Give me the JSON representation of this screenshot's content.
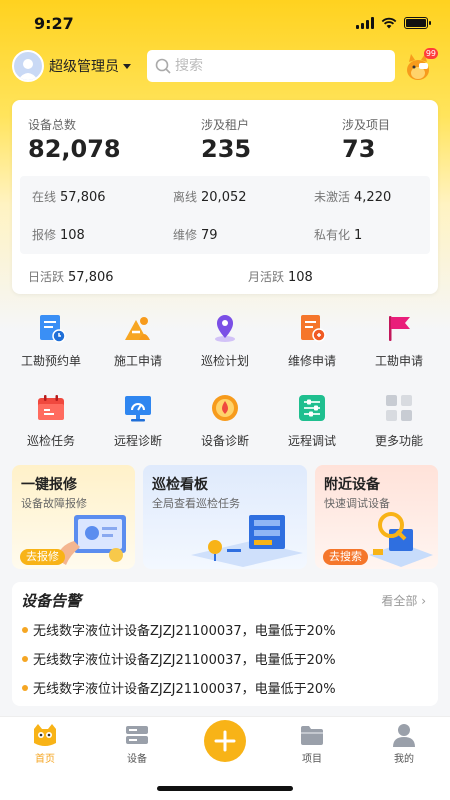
{
  "status_bar": {
    "time": "9:27"
  },
  "header": {
    "user_name": "超级管理员",
    "search_placeholder": "搜索",
    "notification_count": "99"
  },
  "stats": {
    "total_devices_label": "设备总数",
    "total_devices": "82,078",
    "tenants_label": "涉及租户",
    "tenants": "235",
    "projects_label": "涉及项目",
    "projects": "73",
    "online_label": "在线",
    "online": "57,806",
    "offline_label": "离线",
    "offline": "20,052",
    "inactive_label": "未激活",
    "inactive": "4,220",
    "reported_label": "报修",
    "reported": "108",
    "repairing_label": "维修",
    "repairing": "79",
    "private_label": "私有化",
    "private": "1",
    "daily_active_label": "日活跃",
    "daily_active": "57,806",
    "monthly_active_label": "月活跃",
    "monthly_active": "108"
  },
  "menu": [
    {
      "label": "工勘预约单",
      "icon": "survey-order-icon"
    },
    {
      "label": "施工申请",
      "icon": "construction-icon"
    },
    {
      "label": "巡检计划",
      "icon": "location-pin-icon"
    },
    {
      "label": "维修申请",
      "icon": "repair-form-icon"
    },
    {
      "label": "工勘申请",
      "icon": "flag-icon"
    },
    {
      "label": "巡检任务",
      "icon": "calendar-task-icon"
    },
    {
      "label": "远程诊断",
      "icon": "monitor-gauge-icon"
    },
    {
      "label": "设备诊断",
      "icon": "device-diagnosis-icon"
    },
    {
      "label": "远程调试",
      "icon": "sliders-icon"
    },
    {
      "label": "更多功能",
      "icon": "grid-more-icon"
    }
  ],
  "promos": [
    {
      "title": "一键报修",
      "subtitle": "设备故障报修",
      "button": "去报修"
    },
    {
      "title": "巡检看板",
      "subtitle": "全局查看巡检任务"
    },
    {
      "title": "附近设备",
      "subtitle": "快速调试设备",
      "button": "去搜索"
    }
  ],
  "alerts": {
    "title": "设备告警",
    "more": "看全部",
    "items": [
      "无线数字液位计设备ZJZJ21100037，电量低于20%",
      "无线数字液位计设备ZJZJ21100037，电量低于20%",
      "无线数字液位计设备ZJZJ21100037，电量低于20%"
    ]
  },
  "tabs": [
    {
      "label": "首页",
      "icon": "home-icon"
    },
    {
      "label": "设备",
      "icon": "device-icon"
    },
    {
      "label": "项目",
      "icon": "folder-icon"
    },
    {
      "label": "我的",
      "icon": "profile-icon"
    }
  ],
  "colors": {
    "accent": "#f8b317",
    "alert_dot": "#f5a623",
    "header_bg": "#ffd21f"
  }
}
